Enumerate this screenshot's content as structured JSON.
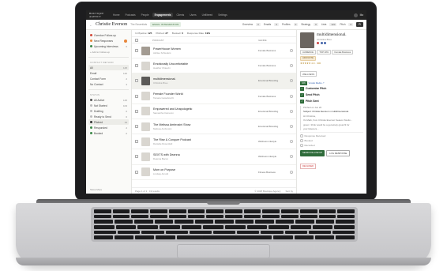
{
  "topnav": {
    "brand": "BOUTIQUE AGENCY",
    "links": [
      "Home",
      "Podcasts",
      "People",
      "Engagements",
      "Clients",
      "Users",
      "Unfiltered",
      "Settings"
    ],
    "active_index": 3,
    "user_initial": "Ka",
    "user_name": "Ma"
  },
  "header": {
    "back": "←",
    "title": "Christie Everson",
    "subtitle": "The Essentials",
    "badge": "EMAIL INTEGRATION",
    "tabs": [
      "Overview",
      "Emails",
      "Profiles",
      "Strategy",
      "Lists",
      "Pitch"
    ],
    "counts": [
      "3",
      "0",
      "0",
      "0",
      "120",
      "0"
    ],
    "action": "Pi"
  },
  "sidebar": {
    "top_items": [
      {
        "label": "Overdue Follow-up",
        "count": "",
        "dot": "#d24a3a"
      },
      {
        "label": "New Responses",
        "count": "",
        "dot": "#e8863a",
        "badge": true
      },
      {
        "label": "Upcoming Interviews",
        "count": "6",
        "dot": "#3e8a4a"
      }
    ],
    "add_link": "+ Add to Follow-up",
    "sec_contact": "CONTACT METHOD",
    "contact_items": [
      {
        "label": "All",
        "count": "125",
        "sel": true
      },
      {
        "label": "Email",
        "count": "120"
      },
      {
        "label": "Contact Form",
        "count": "2"
      },
      {
        "label": "No Contact",
        "count": "3"
      }
    ],
    "sec_status": "STATUS",
    "status_items": [
      {
        "label": "All Active",
        "count": "125",
        "dot": "#555"
      },
      {
        "label": "Not Started",
        "count": "103",
        "dot": "#bbb"
      },
      {
        "label": "Drafting",
        "count": "0",
        "dot": "#bbb"
      },
      {
        "label": "Ready to Send",
        "count": "0",
        "dot": "#bbb"
      },
      {
        "label": "Pitched",
        "count": "19",
        "dot": "#333",
        "sel": true
      },
      {
        "label": "Responded",
        "count": "2",
        "dot": "#3e8a4a"
      },
      {
        "label": "Booked",
        "count": "0",
        "dot": "#3e8a4a"
      }
    ],
    "foot": "Show More"
  },
  "list": {
    "stats": [
      {
        "label": "In Pipeline",
        "value": "125"
      },
      {
        "label": "Pitched",
        "value": "27"
      },
      {
        "label": "Booked",
        "value": "0"
      },
      {
        "label": "Response Rate",
        "value": "19%"
      }
    ],
    "col_podcast": "PODCAST",
    "col_genre": "GENRE",
    "rows": [
      {
        "title": "PowerHouse Women",
        "sub": "Ashlee Schieders",
        "tag": "Female Business",
        "thumb": "mid"
      },
      {
        "title": "Emotionally Uncomfortable",
        "sub": "Heather Chauvin",
        "tag": "Female Business",
        "thumb": "light"
      },
      {
        "title": "multidimensional.",
        "sub": "Christina Bree",
        "tag": "Emotional Branding",
        "thumb": "dark",
        "sel": true
      },
      {
        "title": "Female Founder World",
        "sub": "Tamara Geisebrecht",
        "tag": "Female Business",
        "thumb": "light"
      },
      {
        "title": "Empowered and Unapologetic",
        "sub": "Samantha Cameron",
        "tag": "Emotional Branding",
        "thumb": "light"
      },
      {
        "title": "The Melissa Ambrosini Show",
        "sub": "Melissa Ambrosini",
        "tag": "Emotional Branding",
        "thumb": "light"
      },
      {
        "title": "The Rise & Conquer Podcast",
        "sub": "Danielle Rosenfeld",
        "tag": "Wellness Lifestyle",
        "thumb": "light"
      },
      {
        "title": "SEXTS with Deanna",
        "sub": "Deanna Bacon",
        "tag": "Wellness Lifestyle",
        "thumb": "light"
      },
      {
        "title": "Mom on Purpose",
        "sub": "Lindsay Arnold",
        "tag": "Fitness Business",
        "thumb": "light"
      }
    ],
    "foot_page": "Page 1 of 1 · 19 results",
    "foot_copy": "© 2025 Boutique Agency",
    "foot_right": "Sort by"
  },
  "detail": {
    "name": "multidimensional.",
    "role": "Christina Bree",
    "chips": [
      "AUDIENCE",
      "TOP 10%",
      "Female Business"
    ],
    "chip_warm": "ADD NOTE",
    "rating": "★★★★★ 4.9 · 300",
    "tag": "WELLNESS",
    "status_badge": "106",
    "status_link": "Vocals Media ↗",
    "steps": [
      {
        "label": "Customize Pitch",
        "done": true
      },
      {
        "label": "Send Pitch",
        "done": true
      },
      {
        "label": "Pitch Sent",
        "done": true
      }
    ],
    "email_lines": [
      "Pitched on Jun 20",
      "Subject: Christie Everson x multidimensional.",
      "Hi Christina,",
      "It's Mark, from Christie Everson Season Studio -",
      "great. I think would be a genuinely great fit for",
      "your listeners..."
    ],
    "radios": [
      "Response Received",
      "Booked",
      "Recorded"
    ],
    "btn_primary": "SEND FOLLOW-UP",
    "btn_secondary": "LOG RESPONSE",
    "btn_danger": "DECLINED"
  }
}
